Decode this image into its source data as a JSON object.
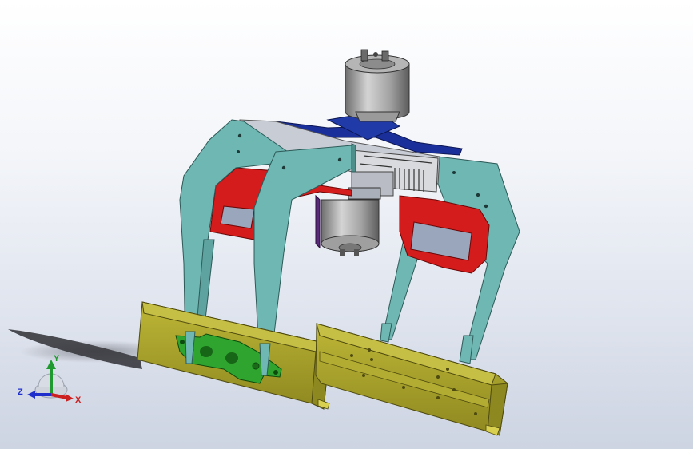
{
  "triad": {
    "x_label": "X",
    "y_label": "Y",
    "z_label": "Z",
    "x_color": "#cc1f1f",
    "y_color": "#1f9a2f",
    "z_color": "#1f2fcc"
  },
  "colors": {
    "frame": "#6fb7b3",
    "frame_dark": "#4e8f8c",
    "bracket": "#d41c1c",
    "bracket_dark": "#9c1010",
    "rail": "#a8a22a",
    "rail_dark": "#777216",
    "plate": "#2fa52f",
    "link": "#1a2f9a",
    "motor": "#8a8a8a",
    "motor_light": "#c9c9c9",
    "purple": "#5a2a7a"
  }
}
